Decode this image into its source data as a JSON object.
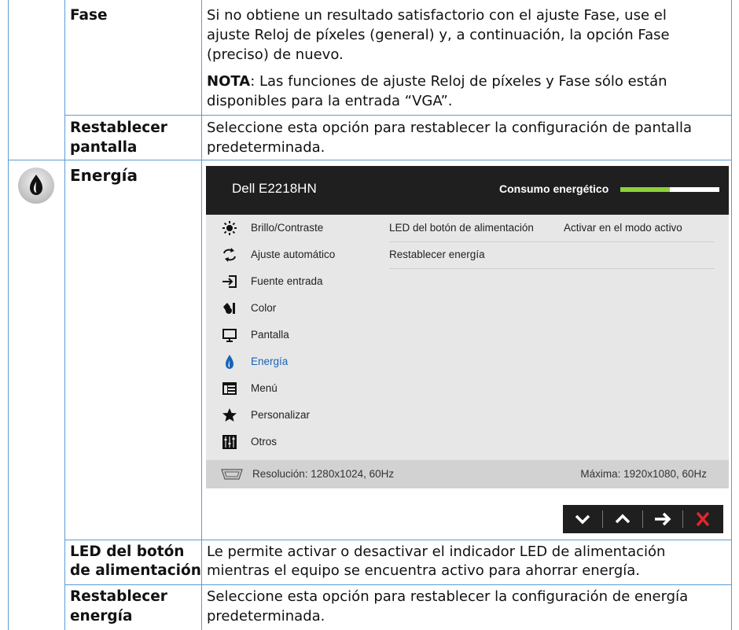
{
  "rows": {
    "fase": {
      "label": "Fase",
      "desc_line1": "Si no obtiene un resultado satisfactorio con el ajuste Fase, use el",
      "desc_line2": "ajuste Reloj de píxeles (general) y, a continuación, la opción Fase",
      "desc_line3": "(preciso) de nuevo.",
      "note_bold": "NOTA",
      "note_line1": ": Las funciones de ajuste Reloj de píxeles y Fase sólo están",
      "note_line2": "disponibles para la entrada “VGA”."
    },
    "reset_display": {
      "label_line1": "Restablecer",
      "label_line2": "pantalla",
      "desc_line1": "Seleccione esta opción para restablecer la configuración de pantalla",
      "desc_line2": "predeterminada."
    },
    "energy": {
      "label": "Energía",
      "icon": "flame-drop-icon"
    },
    "led": {
      "label_line1": "LED del botón",
      "label_line2": "de alimentación",
      "desc_line1": "Le permite activar o desactivar el indicador LED de alimentación",
      "desc_line2": "mientras el equipo se encuentra activo para ahorrar energía."
    },
    "reset_energy": {
      "label_line1": "Restablecer",
      "label_line2": "energía",
      "desc_line1": "Seleccione esta opción para restablecer la configuración de energía",
      "desc_line2": "predeterminada."
    }
  },
  "osd": {
    "model": "Dell E2218HN",
    "power_label": "Consumo energético",
    "power_level": 0.5,
    "menu": [
      {
        "label": "Brillo/Contraste",
        "icon": "sun-icon"
      },
      {
        "label": "Ajuste automático",
        "icon": "auto-adjust-icon"
      },
      {
        "label": "Fuente entrada",
        "icon": "input-source-icon"
      },
      {
        "label": "Color",
        "icon": "color-icon"
      },
      {
        "label": "Pantalla",
        "icon": "monitor-icon"
      },
      {
        "label": "Energía",
        "icon": "energy-icon"
      },
      {
        "label": "Menú",
        "icon": "menu-icon"
      },
      {
        "label": "Personalizar",
        "icon": "star-icon"
      },
      {
        "label": "Otros",
        "icon": "sliders-icon"
      }
    ],
    "active_item": "Energía",
    "submenu": [
      {
        "label": "LED del botón de alimentación",
        "value": "Activar en el modo activo"
      },
      {
        "label": "Restablecer energía",
        "value": ""
      }
    ],
    "resolution": "Resolución: 1280x1024, 60Hz",
    "max_resolution": "Máxima: 1920x1080, 60Hz",
    "buttons": [
      "down-arrow-icon",
      "up-arrow-icon",
      "right-arrow-icon",
      "close-x-icon"
    ]
  },
  "colors": {
    "table_border": "#5b9bd5",
    "power_bar": "#8cd13a",
    "active_item": "#1a64b8",
    "close_button": "#e3262b"
  }
}
